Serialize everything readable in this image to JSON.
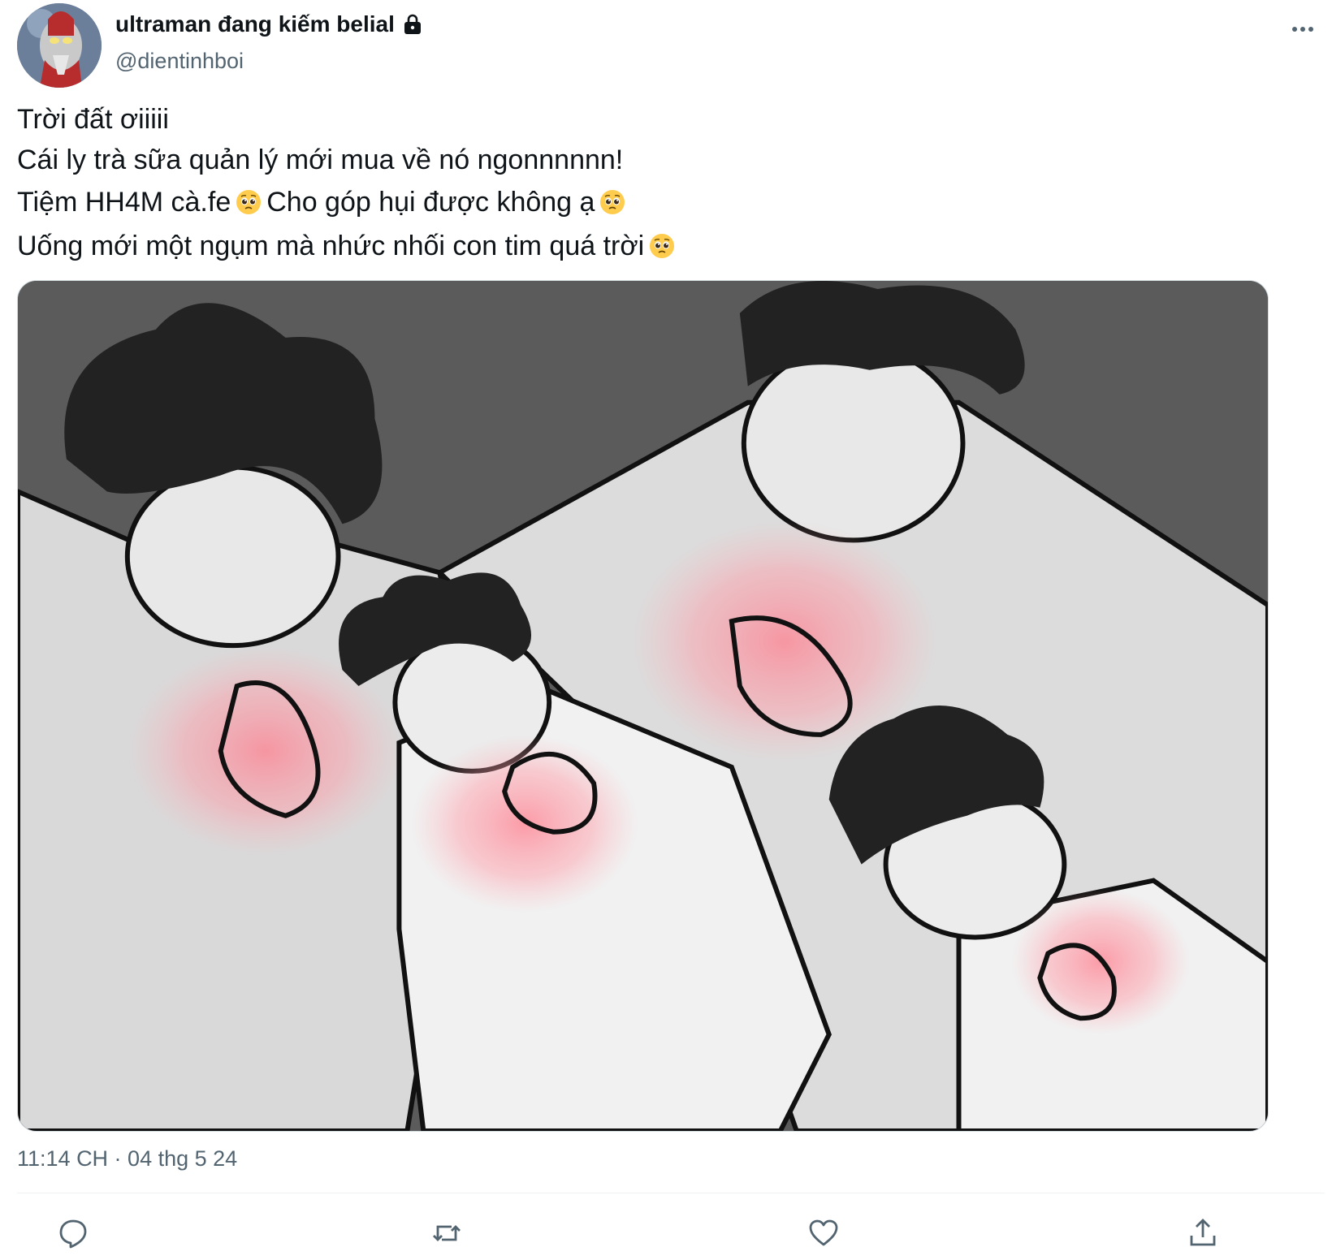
{
  "user": {
    "display_name": "ultraman đang kiếm belial",
    "handle": "@dientinhboi",
    "protected_icon": "lock-icon",
    "avatar": "avatar-ultraman"
  },
  "tweet": {
    "lines": [
      "Trời đất ơiiiii",
      "Cái ly trà sữa quản lý mới mua về nó ngonnnnnn!",
      "Tiệm HH4M cà.fe",
      "Cho góp hụi được không ạ",
      "Uống mới một ngụm mà nhức nhối con tim quá trời"
    ],
    "emoji": "pleading-face-emoji",
    "media": "meme-image-heart-clutching-figures",
    "timestamp": "11:14 CH · 04 thg 5 24"
  },
  "actions": {
    "reply_icon": "reply-icon",
    "retweet_icon": "retweet-icon",
    "like_icon": "heart-icon",
    "share_icon": "share-icon",
    "more_icon": "more-horizontal-icon"
  },
  "colors": {
    "text": "#0f1419",
    "secondary": "#536471",
    "divider": "#eff3f4",
    "media_bg": "#5b5b5b"
  }
}
